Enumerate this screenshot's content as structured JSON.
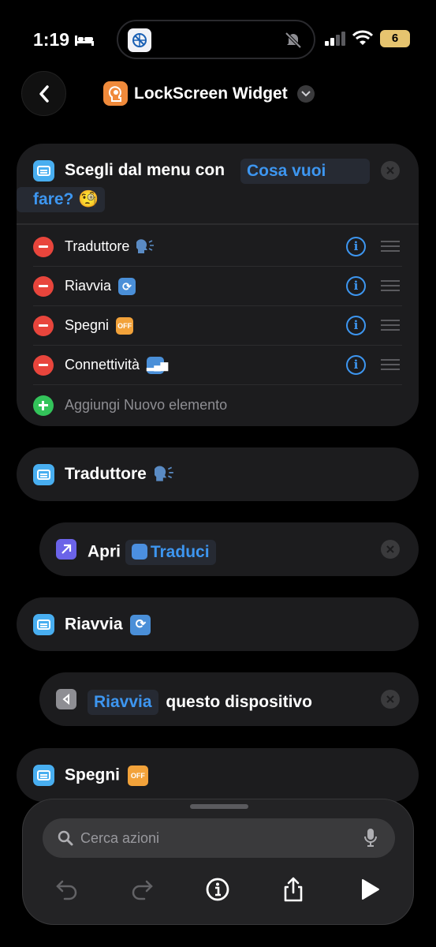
{
  "status_bar": {
    "time": "1:19",
    "battery": "6"
  },
  "nav": {
    "title": "LockScreen Widget"
  },
  "menu_action": {
    "prefix": "Scegli dal menu con",
    "prompt_part1": "Cosa vuoi",
    "prompt_part2": "fare? 🧐",
    "items": [
      {
        "label": "Traduttore"
      },
      {
        "label": "Riavvia"
      },
      {
        "label": "Spegni"
      },
      {
        "label": "Connettività"
      }
    ],
    "add_label": "Aggiungi Nuovo elemento"
  },
  "blocks": {
    "case1": "Traduttore",
    "open_verb": "Apri",
    "open_app": "Traduci",
    "case2": "Riavvia",
    "restart_param": "Riavvia",
    "restart_text": "questo dispositivo",
    "case3": "Spegni"
  },
  "bottom_sheet": {
    "search_placeholder": "Cerca azioni"
  },
  "colors": {
    "accent": "#3d96f0",
    "card": "#1c1c1e",
    "delete": "#e8453c",
    "add": "#33c35a"
  }
}
